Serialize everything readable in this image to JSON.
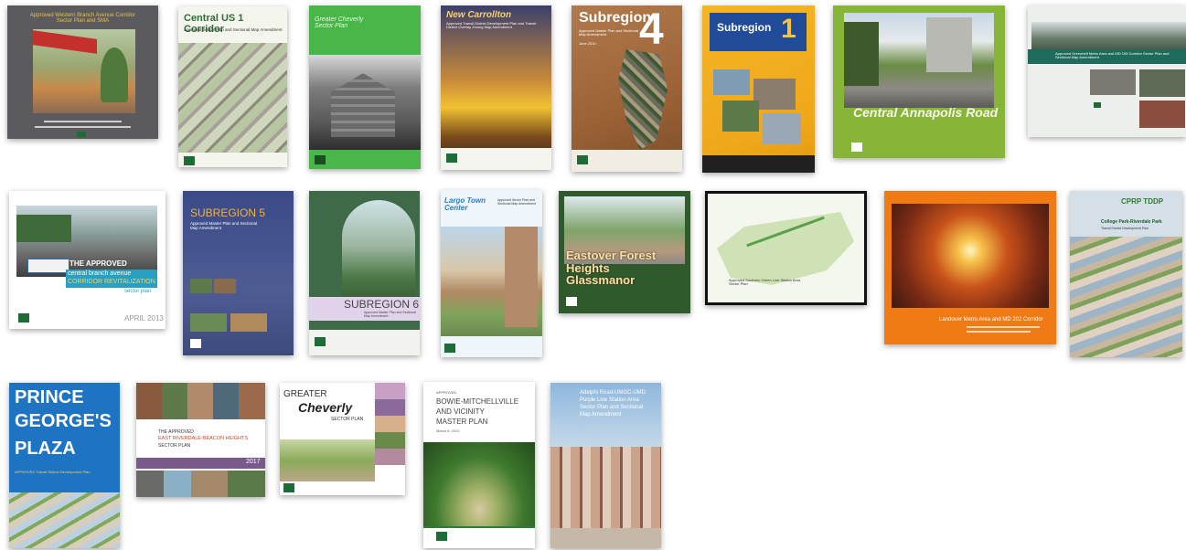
{
  "gallery": {
    "covers": [
      {
        "title": "Approved Western Branch Avenue Corridor Sector Plan and SMA"
      },
      {
        "title": "Central US 1 Corridor",
        "subtitle": "Approved Sector Plan and Sectional Map Amendment"
      },
      {
        "title": "Greater Cheverly Sector Plan"
      },
      {
        "title": "New Carrollton",
        "subtitle": "Approved Transit District Development Plan and Transit District Overlay Zoning Map Amendment"
      },
      {
        "title": "Subregion",
        "number": "4",
        "subtitle": "Approved Master Plan and Sectional Map Amendment",
        "date": "June 2010"
      },
      {
        "title": "Subregion",
        "number": "1"
      },
      {
        "title": "Central Annapolis Road"
      },
      {
        "title": "Approved Greenbelt Metro Area and MD 193 Corridor Sector Plan and Sectional Map Amendment"
      },
      {
        "title_1": "THE APPROVED",
        "title_2": "central branch avenue",
        "title_3": "CORRIDOR REVITALIZATION",
        "title_4": "sector plan",
        "date": "APRIL 2013"
      },
      {
        "title": "SUBREGION 5",
        "subtitle": "Approved Master Plan and Sectional Map Amendment"
      },
      {
        "title": "SUBREGION 6",
        "subtitle": "Approved Master Plan and Sectional Map Amendment"
      },
      {
        "title": "Largo Town Center",
        "subtitle": "Approved Sector Plan and Sectional Map Amendment"
      },
      {
        "title": "Eastover Forest Heights Glassmanor"
      },
      {
        "title": "Approved Southern Green Line Station Area Sector Plan"
      },
      {
        "title": "Landover Metro Area and MD 202 Corridor"
      },
      {
        "title_1": "CPRP TDDP",
        "title_2": "College Park-Riverdale Park",
        "subtitle": "Transit District Development Plan"
      },
      {
        "title_1": "PRINCE",
        "title_2": "GEORGE'S",
        "title_3": "PLAZA",
        "subtitle": "APPROVED Transit District Development Plan"
      },
      {
        "title_1": "THE APPROVED",
        "title_2": "EAST RIVERDALE-BEACON HEIGHTS",
        "title_3": "SECTOR PLAN",
        "year": "2017"
      },
      {
        "title_1": "GREATER",
        "title_2": "Cheverly",
        "title_3": "SECTOR PLAN"
      },
      {
        "title_1": "APPROVED",
        "title_2": "BOWIE-MITCHELLVILLE",
        "title_3": "AND VICINITY",
        "title_4": "MASTER PLAN",
        "date": "March 8, 2022"
      },
      {
        "title_1": "Adelphi Road-UMGC-UMD",
        "title_2": "Purple Line Station Area",
        "title_3": "Sector Plan and Sectional",
        "title_4": "Map Amendment"
      }
    ]
  },
  "colors": {
    "brand_green": "#1d6b36",
    "bowie_green": "#2f7a3a"
  }
}
